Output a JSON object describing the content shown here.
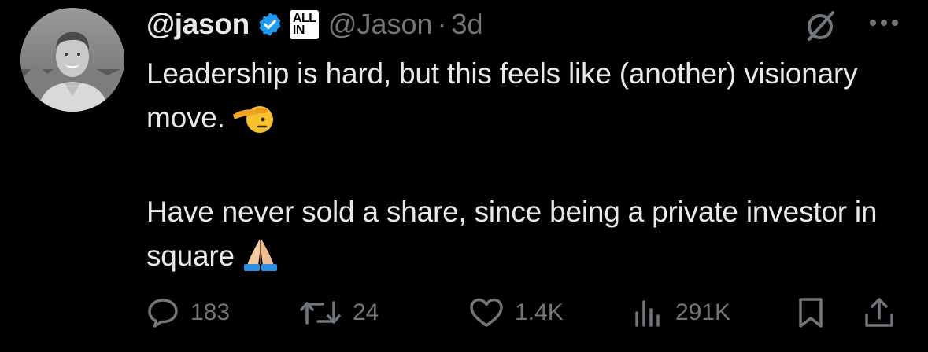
{
  "tweet": {
    "display_name": "@jason",
    "verified_icon": "verified-badge-icon",
    "affiliate_badge": {
      "line1": "ALL",
      "line2": "IN"
    },
    "handle": "@Jason",
    "separator": "·",
    "time": "3d",
    "paragraphs": [
      "Leadership is hard, but this feels like (another) visionary move.",
      "Have never sold a share, since being a private investor in square"
    ],
    "emojis": [
      "saluting-face-emoji",
      "folded-hands-emoji"
    ]
  },
  "actions": {
    "replies": "183",
    "reposts": "24",
    "likes": "1.4K",
    "views": "291K"
  },
  "colors": {
    "background": "#000000",
    "text": "#e7e9ea",
    "muted": "#71767b",
    "verified": "#1d9bf0"
  }
}
